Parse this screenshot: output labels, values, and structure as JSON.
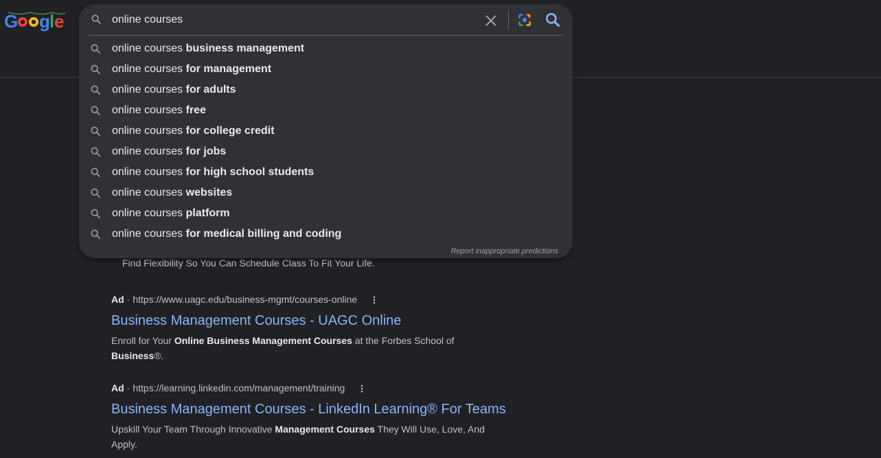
{
  "logo": {
    "alt": "Google"
  },
  "search": {
    "query": "online courses",
    "suggestions": [
      {
        "prefix": "online courses ",
        "completion": "business management"
      },
      {
        "prefix": "online courses ",
        "completion": "for management"
      },
      {
        "prefix": "online courses ",
        "completion": "for adults"
      },
      {
        "prefix": "online courses ",
        "completion": "free"
      },
      {
        "prefix": "online courses ",
        "completion": "for college credit"
      },
      {
        "prefix": "online courses ",
        "completion": "for jobs"
      },
      {
        "prefix": "online courses ",
        "completion": "for high school students"
      },
      {
        "prefix": "online courses ",
        "completion": "websites"
      },
      {
        "prefix": "online courses ",
        "completion": "platform"
      },
      {
        "prefix": "online courses ",
        "completion": "for medical billing and coding"
      }
    ],
    "report_label": "Report inappropriate predictions"
  },
  "results": {
    "partial_description": "Find Flexibility So You Can Schedule Class To Fit Your Life.",
    "ads": [
      {
        "label": "Ad",
        "separator": "·",
        "url": "https://www.uagc.edu/business-mgmt/courses-online",
        "title": "Business Management Courses - UAGC Online",
        "desc": {
          "part1": "Enroll for Your ",
          "bold1": "Online Business Management Courses",
          "part2": " at the Forbes School of ",
          "bold2": "Business",
          "part3": "®."
        }
      },
      {
        "label": "Ad",
        "separator": "·",
        "url": "https://learning.linkedin.com/management/training",
        "title": "Business Management Courses - LinkedIn Learning® For Teams",
        "desc": {
          "part1": "Upskill Your Team Through Innovative ",
          "bold1": "Management Courses",
          "part2": " They Will Use, Love, And Apply.",
          "bold2": "",
          "part3": ""
        }
      }
    ]
  },
  "icons": {
    "search": "search-icon",
    "clear": "close-icon",
    "lens": "camera-icon",
    "more": "more-vert-icon"
  },
  "colors": {
    "background": "#202124",
    "panel": "#303134",
    "link": "#8ab4f8",
    "text": "#e8eaed",
    "muted": "#bdc1c6"
  }
}
